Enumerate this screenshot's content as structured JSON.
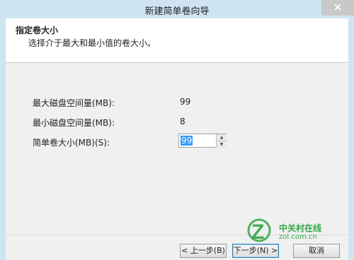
{
  "window": {
    "title": "新建简单卷向导",
    "close_glyph": "✕"
  },
  "header": {
    "title": "指定卷大小",
    "description": "选择介于最大和最小值的卷大小。"
  },
  "form": {
    "max_label": "最大磁盘空间量(MB):",
    "max_value": "99",
    "min_label": "最小磁盘空间量(MB):",
    "min_value": "8",
    "size_label": "简单卷大小(MB)(S):",
    "size_value": "99"
  },
  "buttons": {
    "back": "< 上一步(B)",
    "next": "下一步(N) >",
    "cancel": "取消"
  },
  "watermark": {
    "text": "中关村在线",
    "sub": "zol.com.cn"
  },
  "colors": {
    "accent": "#3399ff",
    "watermark": "#35a64a"
  }
}
